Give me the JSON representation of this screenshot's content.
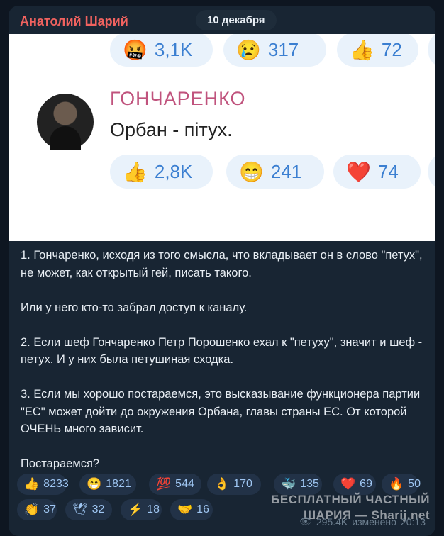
{
  "header": {
    "author": "Анатолий Шарий",
    "date": "10 декабря"
  },
  "screenshot": {
    "top_reactions": [
      {
        "icon": "angry-emoji-icon",
        "glyph": "🤬",
        "count": "3,1K"
      },
      {
        "icon": "crying-emoji-icon",
        "glyph": "😢",
        "count": "317"
      },
      {
        "icon": "thumbs-up-emoji-icon",
        "glyph": "👍",
        "count": "72"
      }
    ],
    "name": "ГОНЧАРЕНКО",
    "text": "Орбан - пітух.",
    "bottom_reactions": [
      {
        "icon": "thumbs-up-emoji-icon",
        "glyph": "👍",
        "count": "2,8K"
      },
      {
        "icon": "grinning-emoji-icon",
        "glyph": "😁",
        "count": "241"
      },
      {
        "icon": "heart-emoji-icon",
        "glyph": "❤️",
        "count": "74"
      }
    ]
  },
  "message": {
    "paragraphs": [
      "1. Гончаренко, исходя из того смысла, что вкладывает он в слово \"петух\", не может, как открытый гей, писать такого.",
      "Или у него кто-то забрал доступ к каналу.",
      "2. Если шеф Гончаренко Петр Порошенко ехал к \"петуху\", значит и шеф - петух. И у них была петушиная сходка.",
      "3. Если мы хорошо постараемся, это высказывание функционера партии \"ЕС\" может дойти до окружения Орбана, главы страны ЕС. От которой ОЧЕНЬ много зависит.",
      "Постараемся?"
    ]
  },
  "reactions": [
    {
      "icon": "thumbs-up-icon",
      "glyph": "👍",
      "count": "8233"
    },
    {
      "icon": "grinning-icon",
      "glyph": "😁",
      "count": "1821"
    },
    {
      "icon": "hundred-icon",
      "glyph": "💯",
      "count": "544"
    },
    {
      "icon": "ok-hand-icon",
      "glyph": "👌",
      "count": "170"
    },
    {
      "icon": "whale-icon",
      "glyph": "🐳",
      "count": "135"
    },
    {
      "icon": "heart-icon",
      "glyph": "❤️",
      "count": "69"
    },
    {
      "icon": "fire-icon",
      "glyph": "🔥",
      "count": "50"
    },
    {
      "icon": "clap-icon",
      "glyph": "👏",
      "count": "37"
    },
    {
      "icon": "dove-icon",
      "glyph": "🕊",
      "count": "32"
    },
    {
      "icon": "lightning-icon",
      "glyph": "⚡",
      "count": "18"
    },
    {
      "icon": "handshake-icon",
      "glyph": "🤝",
      "count": "16"
    }
  ],
  "meta": {
    "views": "295.4K",
    "edited": "изменено",
    "time": "20:13"
  },
  "watermark": {
    "line1": "БЕСПЛАТНЫЙ ЧАСТНЫЙ",
    "line2": "ШАРИЯ — Sharij.net"
  }
}
